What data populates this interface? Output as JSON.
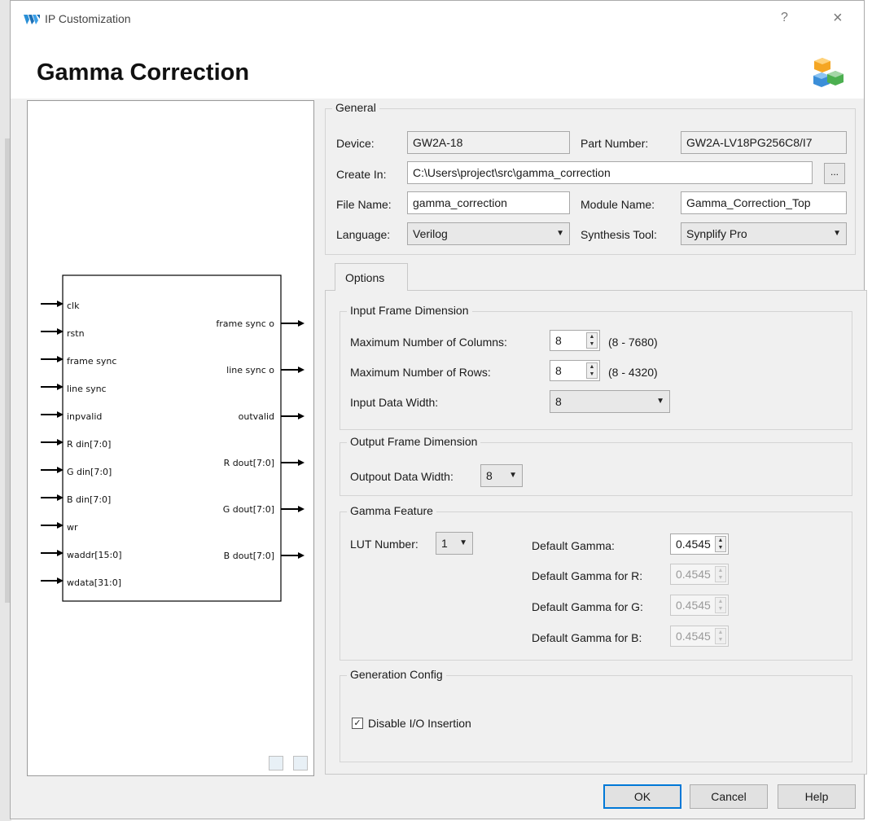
{
  "window": {
    "title": "IP Customization",
    "help_glyph": "?",
    "close_glyph": "×"
  },
  "header": {
    "title": "Gamma Correction"
  },
  "preview": {
    "inputs": [
      "clk",
      "rstn",
      "frame sync",
      "line sync",
      "inpvalid",
      "R din[7:0]",
      "G din[7:0]",
      "B din[7:0]",
      "wr",
      "waddr[15:0]",
      "wdata[31:0]"
    ],
    "outputs": [
      "frame sync o",
      "line sync o",
      "outvalid",
      "R dout[7:0]",
      "G dout[7:0]",
      "B dout[7:0]"
    ]
  },
  "general": {
    "legend": "General",
    "device_label": "Device:",
    "device_value": "GW2A-18",
    "part_number_label": "Part Number:",
    "part_number_value": "GW2A-LV18PG256C8/I7",
    "create_in_label": "Create In:",
    "create_in_value": "C:\\Users\\project\\src\\gamma_correction",
    "browse_label": "...",
    "file_name_label": "File Name:",
    "file_name_value": "gamma_correction",
    "module_name_label": "Module Name:",
    "module_name_value": "Gamma_Correction_Top",
    "language_label": "Language:",
    "language_value": "Verilog",
    "synthesis_tool_label": "Synthesis Tool:",
    "synthesis_tool_value": "Synplify Pro"
  },
  "options": {
    "tab_label": "Options",
    "input_frame": {
      "legend": "Input Frame Dimension",
      "max_columns_label": "Maximum Number of Columns:",
      "max_columns_value": "8",
      "max_columns_range": "(8 - 7680)",
      "max_rows_label": "Maximum Number of Rows:",
      "max_rows_value": "8",
      "max_rows_range": "(8 - 4320)",
      "data_width_label": "Input Data Width:",
      "data_width_value": "8"
    },
    "output_frame": {
      "legend": "Output Frame Dimension",
      "data_width_label": "Outpout Data Width:",
      "data_width_value": "8"
    },
    "gamma_feature": {
      "legend": "Gamma Feature",
      "lut_label": "LUT Number:",
      "lut_value": "1",
      "default_gamma_label": "Default Gamma:",
      "default_gamma_value": "0.4545",
      "gamma_r_label": "Default Gamma for R:",
      "gamma_r_value": "0.4545",
      "gamma_g_label": "Default Gamma for G:",
      "gamma_g_value": "0.4545",
      "gamma_b_label": "Default Gamma for B:",
      "gamma_b_value": "0.4545"
    },
    "generation": {
      "legend": "Generation Config",
      "disable_io_label": "Disable I/O Insertion",
      "disable_io_checked": true
    }
  },
  "buttons": {
    "ok": "OK",
    "cancel": "Cancel",
    "help": "Help"
  },
  "colors": {
    "accent": "#0078d7",
    "panel": "#f0f0f0"
  }
}
